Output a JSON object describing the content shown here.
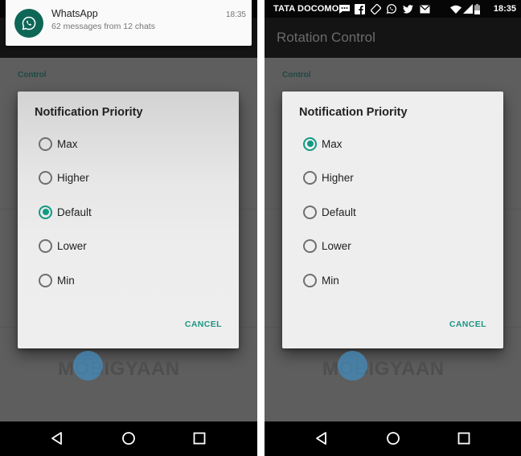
{
  "left_screen": {
    "notification": {
      "app_name": "WhatsApp",
      "text": "62 messages from 12 chats",
      "time": "18:35",
      "icon": "whatsapp-icon"
    },
    "section_header": "Control",
    "dialog": {
      "title": "Notification Priority",
      "options": [
        {
          "label": "Max",
          "checked": false
        },
        {
          "label": "Higher",
          "checked": false
        },
        {
          "label": "Default",
          "checked": true
        },
        {
          "label": "Lower",
          "checked": false
        },
        {
          "label": "Min",
          "checked": false
        }
      ],
      "selected": "Default",
      "cancel_label": "CANCEL"
    },
    "watermark": "MOBIGYAAN",
    "nav": {
      "back": "back-icon",
      "home": "home-icon",
      "recents": "recents-icon"
    }
  },
  "right_screen": {
    "status_bar": {
      "carrier": "TATA DOCOMO",
      "notification_icons": [
        "message-icon",
        "facebook-icon",
        "rotation-icon",
        "whatsapp-icon",
        "twitter-icon",
        "email-icon"
      ],
      "system_icons": [
        "wifi-icon",
        "signal-icon",
        "battery-icon"
      ],
      "time": "18:35"
    },
    "app_bar_title": "Rotation Control",
    "section_header": "Control",
    "dialog": {
      "title": "Notification Priority",
      "options": [
        {
          "label": "Max",
          "checked": true
        },
        {
          "label": "Higher",
          "checked": false
        },
        {
          "label": "Default",
          "checked": false
        },
        {
          "label": "Lower",
          "checked": false
        },
        {
          "label": "Min",
          "checked": false
        }
      ],
      "selected": "Max",
      "cancel_label": "CANCEL"
    },
    "watermark": "MOBIGYAAN",
    "nav": {
      "back": "back-icon",
      "home": "home-icon",
      "recents": "recents-icon"
    }
  },
  "colors": {
    "accent": "#129985",
    "scrim_background": "#5f5f5f",
    "dialog_background": "#eeeeee",
    "whatsapp_green": "#0e6657"
  }
}
